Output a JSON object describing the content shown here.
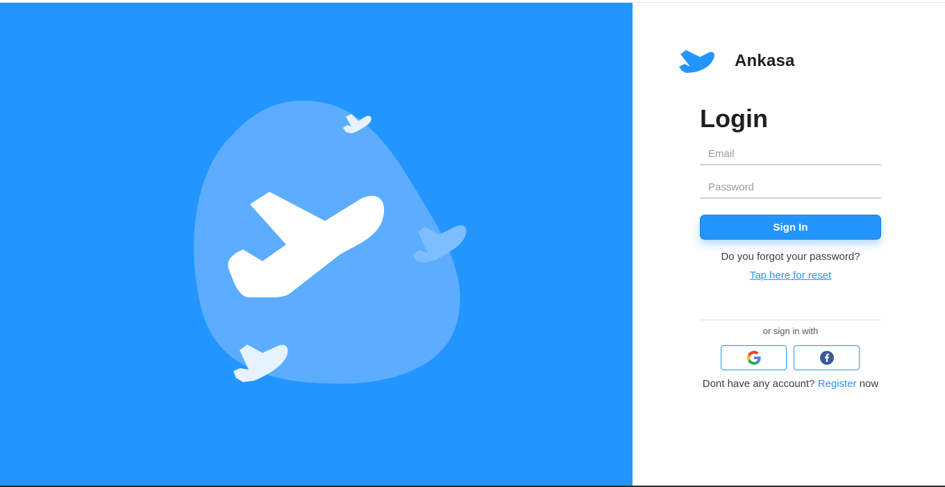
{
  "brand": {
    "name": "Ankasa",
    "logo_icon": "plane-icon",
    "accent_color": "#2395ff"
  },
  "hero": {
    "background_color": "#2395ff",
    "illustration": "airplane-blob-illustration"
  },
  "login": {
    "title": "Login",
    "email_placeholder": "Email",
    "password_placeholder": "Password",
    "sign_in_label": "Sign In",
    "forgot_text": "Do you forgot your password?",
    "reset_link": "Tap here for reset",
    "alt_signin_text": "or sign in with",
    "social": [
      {
        "name": "google",
        "icon": "google-icon"
      },
      {
        "name": "facebook",
        "icon": "facebook-icon"
      }
    ],
    "register_prefix": "Dont have any account?",
    "register_link": "Register",
    "register_suffix": "now"
  }
}
